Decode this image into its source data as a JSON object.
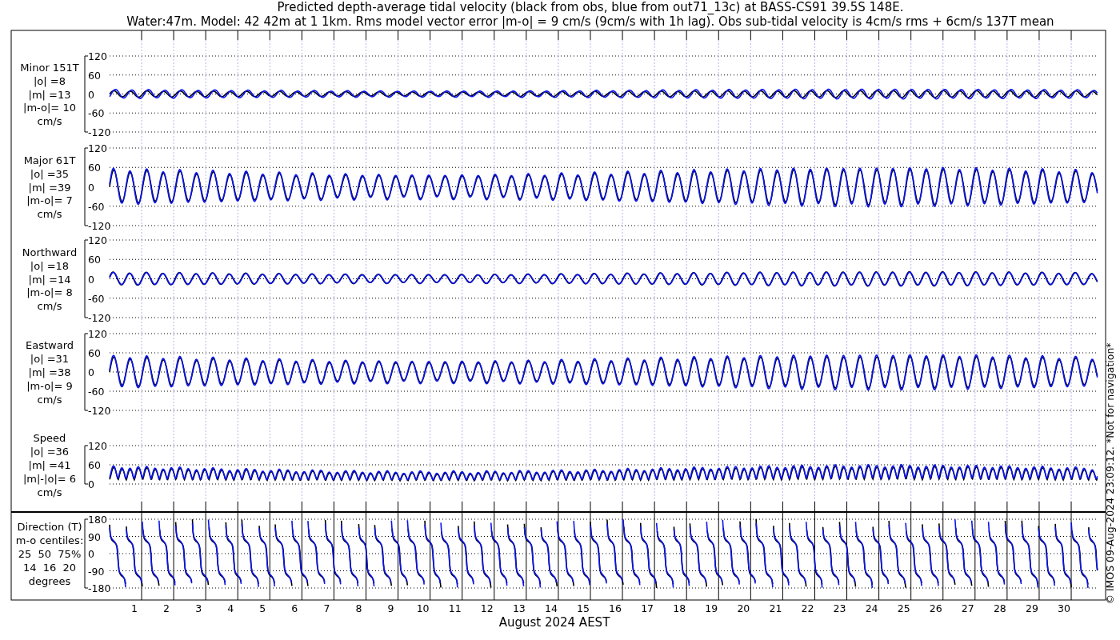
{
  "title_lines": [
    "Predicted depth-average tidal velocity (black from obs, blue from out71_13c) at BASS-CS91 39.5S 148E.",
    "Water:47m. Model: 42 42m at 1 1km. Rms model vector error |m-o| = 9 cm/s (9cm/s with 1h lag). Obs sub-tidal velocity is 4cm/s rms + 6cm/s 137T mean"
  ],
  "panels": [
    {
      "kind": "velocity",
      "label": [
        "Minor 151T",
        "|o| =8",
        "|m| =13",
        "|m-o|= 10",
        "cm/s"
      ],
      "yticks": [
        "120",
        "60",
        "0",
        "-60",
        "-120"
      ]
    },
    {
      "kind": "velocity",
      "label": [
        "Major 61T",
        "|o| =35",
        "|m| =39",
        "|m-o|= 7",
        "cm/s"
      ],
      "yticks": [
        "120",
        "60",
        "0",
        "-60",
        "-120"
      ]
    },
    {
      "kind": "velocity",
      "label": [
        "Northward",
        "|o| =18",
        "|m| =14",
        "|m-o|= 8",
        "cm/s"
      ],
      "yticks": [
        "120",
        "60",
        "0",
        "-60",
        "-120"
      ]
    },
    {
      "kind": "velocity",
      "label": [
        "Eastward",
        "|o| =31",
        "|m| =38",
        "|m-o|= 9",
        "cm/s"
      ],
      "yticks": [
        "120",
        "60",
        "0",
        "-60",
        "-120"
      ]
    },
    {
      "kind": "speed",
      "label": [
        "Speed",
        "|o| =36",
        "|m| =41",
        "|m|-|o|= 6",
        "cm/s"
      ],
      "yticks": [
        "120",
        "60",
        "0"
      ]
    },
    {
      "kind": "direction",
      "label": [
        "Direction (T)",
        "m-o centiles:",
        "25  50  75%",
        "14  16  20",
        "degrees"
      ],
      "yticks": [
        "180",
        "90",
        "0",
        "-90",
        "-180"
      ]
    }
  ],
  "x_tick_labels": [
    "1",
    "2",
    "3",
    "4",
    "5",
    "6",
    "7",
    "8",
    "9",
    "10",
    "11",
    "12",
    "13",
    "14",
    "15",
    "16",
    "17",
    "18",
    "19",
    "20",
    "21",
    "22",
    "23",
    "24",
    "25",
    "26",
    "27",
    "28",
    "29",
    "30"
  ],
  "x_label": "August 2024 AEST",
  "side_note": "© IMOS 09-Aug-2024 23:09:12. *Not for navigation*"
}
